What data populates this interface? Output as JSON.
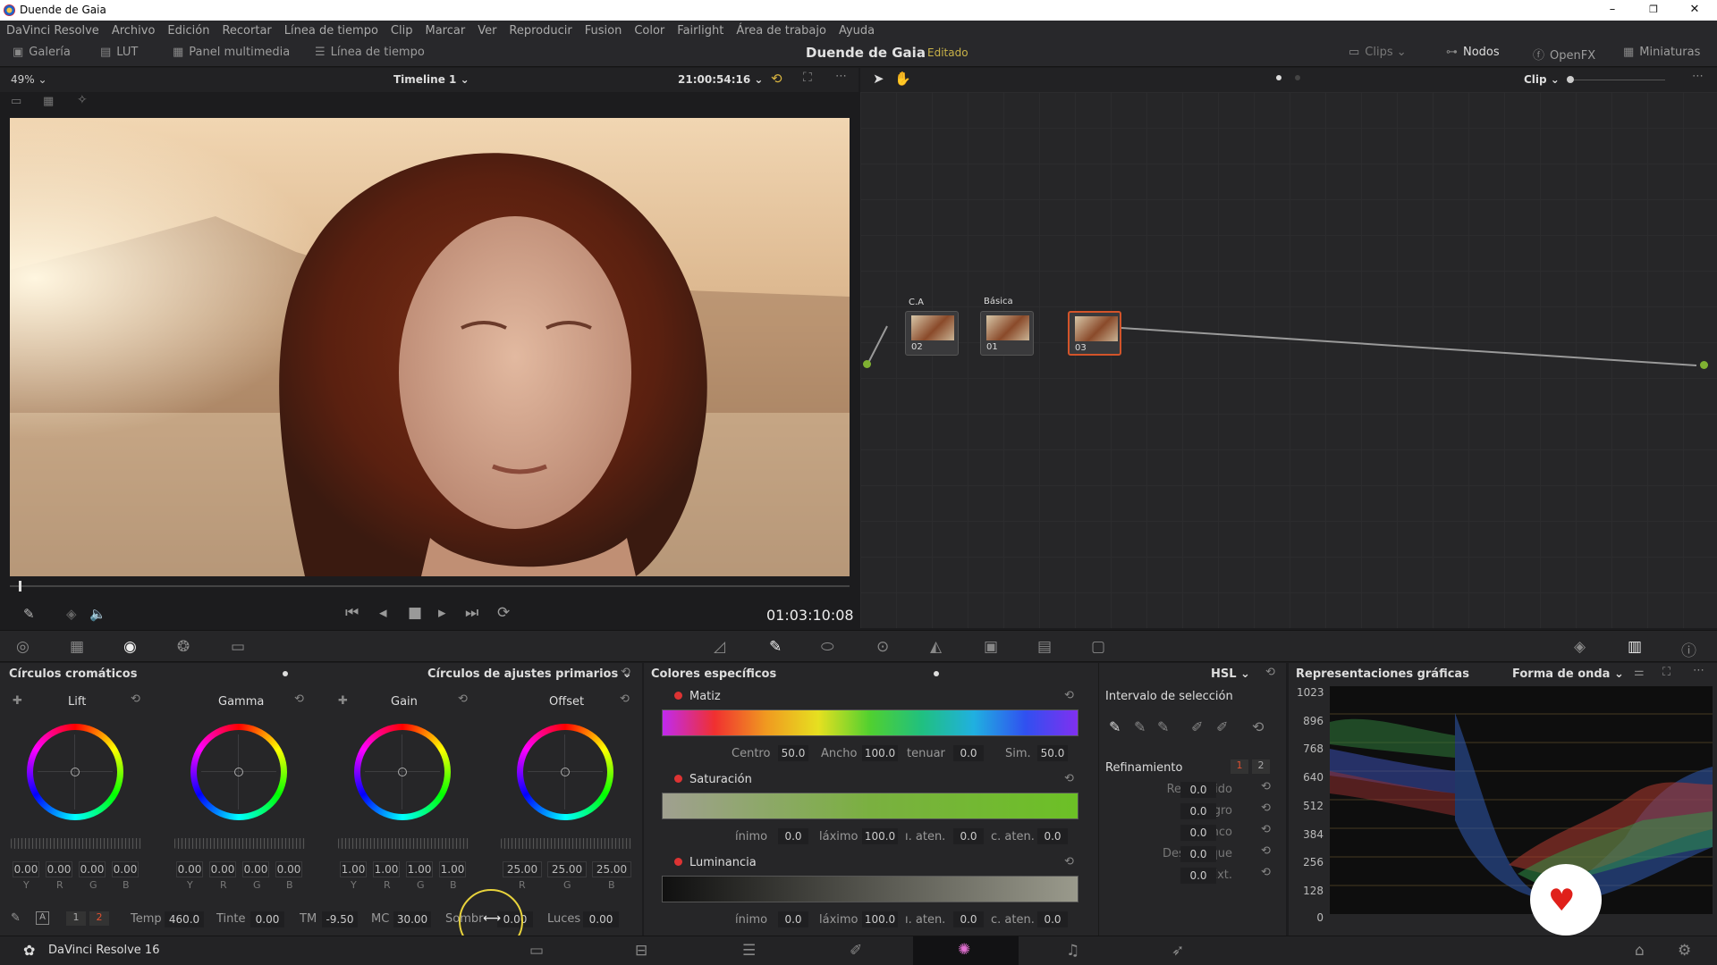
{
  "window": {
    "title": "Duende de Gaia",
    "controls": {
      "minimize": "–",
      "maximize": "❐",
      "close": "✕"
    }
  },
  "menu": [
    "DaVinci Resolve",
    "Archivo",
    "Edición",
    "Recortar",
    "Línea de tiempo",
    "Clip",
    "Marcar",
    "Ver",
    "Reproducir",
    "Fusion",
    "Color",
    "Fairlight",
    "Área de trabajo",
    "Ayuda"
  ],
  "toolbar": {
    "gallery": "Galería",
    "lut": "LUT",
    "media": "Panel multimedia",
    "timeline": "Línea de tiempo",
    "project": "Duende de Gaia",
    "status": "Editado",
    "clips": "Clips",
    "nodes": "Nodos",
    "openfx": "OpenFX",
    "thumbs": "Miniaturas"
  },
  "viewer": {
    "zoom": "49%",
    "timeline": "Timeline 1",
    "timecode_top": "21:00:54:16",
    "timecode": "01:03:10:08",
    "nodemode": "Clip"
  },
  "nodes": [
    {
      "label": "C.A",
      "num": "02"
    },
    {
      "label": "Básica",
      "num": "01"
    },
    {
      "label": "",
      "num": "03"
    }
  ],
  "wheels": {
    "title": "Círculos cromáticos",
    "mode": "Círculos de ajustes primarios",
    "items": [
      {
        "name": "Lift",
        "labels": [
          "Y",
          "R",
          "G",
          "B"
        ],
        "values": [
          "0.00",
          "0.00",
          "0.00",
          "0.00"
        ]
      },
      {
        "name": "Gamma",
        "labels": [
          "Y",
          "R",
          "G",
          "B"
        ],
        "values": [
          "0.00",
          "0.00",
          "0.00",
          "0.00"
        ]
      },
      {
        "name": "Gain",
        "labels": [
          "Y",
          "R",
          "G",
          "B"
        ],
        "values": [
          "1.00",
          "1.00",
          "1.00",
          "1.00"
        ]
      },
      {
        "name": "Offset",
        "labels": [
          "R",
          "G",
          "B"
        ],
        "values": [
          "25.00",
          "25.00",
          "25.00"
        ]
      }
    ],
    "bottom": {
      "p1": "1",
      "p2": "2",
      "temp_l": "Temp",
      "temp": "460.0",
      "tint_l": "Tinte",
      "tint": "0.00",
      "tm_l": "TM",
      "tm": "-9.50",
      "mc_l": "MC",
      "mc": "30.00",
      "shadow_l": "Sombr",
      "shadow": "0.00",
      "lights_l": "Luces",
      "lights": "0.00"
    }
  },
  "qualifier": {
    "title": "Colores específicos",
    "mode": "HSL",
    "hue": {
      "label": "Matiz",
      "f1": "Centro",
      "v1": "50.0",
      "f2": "Ancho",
      "v2": "100.0",
      "f3": "tenuar",
      "v3": "0.0",
      "f4": "Sim.",
      "v4": "50.0"
    },
    "sat": {
      "label": "Saturación",
      "f1": "ínimo",
      "v1": "0.0",
      "f2": "láximo",
      "v2": "100.0",
      "f3": "ı. aten.",
      "v3": "0.0",
      "f4": "c. aten.",
      "v4": "0.0"
    },
    "lum": {
      "label": "Luminancia",
      "f1": "ínimo",
      "v1": "0.0",
      "f2": "láximo",
      "v2": "100.0",
      "f3": "ı. aten.",
      "v3": "0.0",
      "f4": "c. aten.",
      "v4": "0.0"
    },
    "selection": "Intervalo de selección",
    "refine": "Refinamiento",
    "r1": "1",
    "r2": "2",
    "refine_items": [
      {
        "l": "Redu...uido",
        "v": "0.0"
      },
      {
        "l": "Negro",
        "v": "0.0"
      },
      {
        "l": "Blanco",
        "v": "0.0"
      },
      {
        "l": "Desenfoque",
        "v": "0.0"
      },
      {
        "l": "Int./Ext.",
        "v": "0.0"
      }
    ]
  },
  "scopes": {
    "title": "Representaciones gráficas",
    "mode": "Forma de onda",
    "ticks": [
      "1023",
      "896",
      "768",
      "640",
      "512",
      "384",
      "256",
      "128",
      "0"
    ]
  },
  "footer": {
    "app": "DaVinci Resolve 16"
  }
}
